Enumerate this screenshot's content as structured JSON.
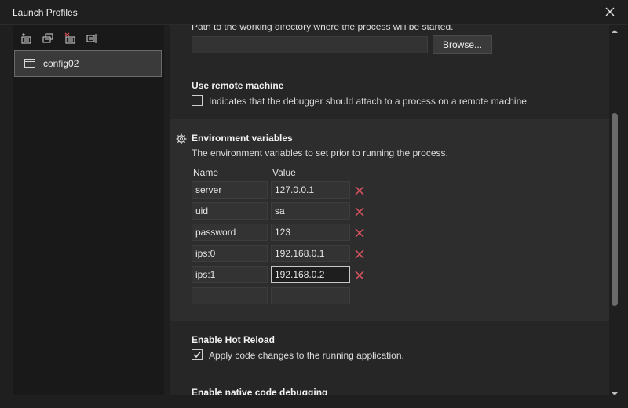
{
  "window": {
    "title": "Launch Profiles"
  },
  "sidebar": {
    "toolbar": [
      {
        "name": "new-profile-icon"
      },
      {
        "name": "copy-profile-icon"
      },
      {
        "name": "delete-profile-icon"
      },
      {
        "name": "rename-profile-icon"
      }
    ],
    "profiles": [
      {
        "label": "config02",
        "selected": true
      }
    ]
  },
  "working_directory": {
    "desc": "Path to the working directory where the process will be started.",
    "value": "",
    "browse_label": "Browse..."
  },
  "remote_machine": {
    "heading": "Use remote machine",
    "desc": "Indicates that the debugger should attach to a process on a remote machine.",
    "checked": false
  },
  "env_vars": {
    "heading": "Environment variables",
    "desc": "The environment variables to set prior to running the process.",
    "col_name": "Name",
    "col_value": "Value",
    "rows": [
      {
        "name": "server",
        "value": "127.0.0.1"
      },
      {
        "name": "uid",
        "value": "sa"
      },
      {
        "name": "password",
        "value": "123"
      },
      {
        "name": "ips:0",
        "value": "192.168.0.1"
      },
      {
        "name": "ips:1",
        "value": "192.168.0.2"
      }
    ],
    "empty_row": {
      "name": "",
      "value": ""
    }
  },
  "hot_reload": {
    "heading": "Enable Hot Reload",
    "desc": "Apply code changes to the running application.",
    "checked": true
  },
  "native_debug": {
    "heading": "Enable native code debugging"
  },
  "colors": {
    "accent_delete": "#e05561",
    "highlight_bg": "#2d2d2d"
  }
}
